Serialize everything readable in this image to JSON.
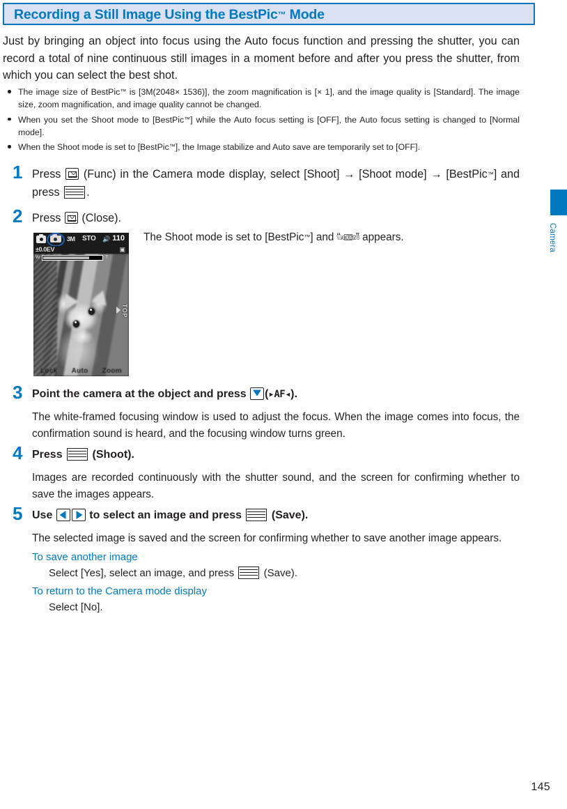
{
  "header": {
    "title_part1": "Recording a Still Image Using the BestPic",
    "title_tm": "™",
    "title_part2": " Mode"
  },
  "intro": {
    "paragraph": "Just by bringing an object into focus using the Auto focus function and pressing the shutter, you can record a total of nine continuous still images in a moment before and after you press the shutter, from which you can select the best shot."
  },
  "notes": [
    {
      "text_a": "The image size of BestPic",
      "tm": "™",
      "text_b": " is [3M(2048× 1536)], the zoom magnification is [× 1], and the image quality is [Standard]. The image size, zoom magnification, and image quality cannot be changed."
    },
    {
      "text_a": "When you set the Shoot mode to [BestPic",
      "tm": "™",
      "text_b": "] while the Auto focus setting is [OFF], the Auto focus setting is changed to [Normal mode]."
    },
    {
      "text_a": "When the Shoot mode is set to [BestPic",
      "tm": "™",
      "text_b": "], the Image stabilize and Auto save are temporarily set to [OFF]."
    }
  ],
  "steps": {
    "one": {
      "num": "1",
      "head_a": "Press ",
      "head_b": " (Func) in the Camera mode display, select [Shoot] → [Shoot mode] → [BestPic",
      "head_tm": "™",
      "head_c": "] and press ",
      "head_d": "."
    },
    "two": {
      "num": "2",
      "head_a": "Press ",
      "head_b": " (Close).",
      "caption_a": "The Shoot mode is set to [BestPic",
      "caption_tm": "™",
      "caption_b": "] and “",
      "caption_c": "” appears."
    },
    "three": {
      "num": "3",
      "head_a": "Point the camera at the object and press ",
      "head_af_open": "▸",
      "head_af": "AF",
      "head_af_close": "◂",
      "head_b": ").",
      "head_paren": "(",
      "body": "The white-framed focusing window is used to adjust the focus. When the image comes into focus, the confirmation sound is heard, and the focusing window turns green."
    },
    "four": {
      "num": "4",
      "head_a": "Press ",
      "head_b": " (Shoot).",
      "body": "Images are recorded continuously with the shutter sound, and the screen for confirming whether to save the images appears."
    },
    "five": {
      "num": "5",
      "head_a": "Use ",
      "head_b": " to select an image and press ",
      "head_c": " (Save).",
      "body": "The selected image is saved and the screen for confirming whether to save another image appears.",
      "sub1_title": "To save another image",
      "sub1_a": "Select [Yes], select an image, and press ",
      "sub1_b": " (Save).",
      "sub2_title": "To return to the Camera mode display",
      "sub2_text": "Select [No]."
    }
  },
  "phone_screen": {
    "status": {
      "size_label": "3M",
      "storage_label": "STO",
      "shots_remaining": "110",
      "ev_label": "±0.0EV",
      "sound_icon": "🔊"
    },
    "zoom_bar": {
      "wide_label": "W",
      "tele_label": "T"
    },
    "top_tag": "TOP",
    "softkeys": [
      "Lock",
      "Auto",
      "Zoom"
    ]
  },
  "side_tab": {
    "label": "Camera"
  },
  "footer": {
    "page_number": "145"
  },
  "colors": {
    "accent_blue": "#0079c1",
    "header_fill": "#d9e1f2",
    "header_border": "#0b76bf",
    "text": "#231f20"
  }
}
